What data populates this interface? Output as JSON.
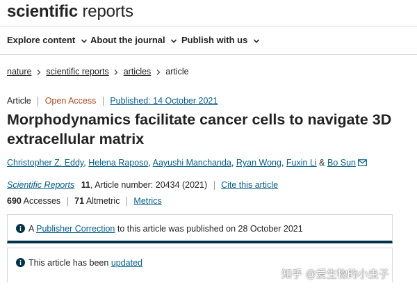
{
  "header": {
    "logo_bold": "scientific",
    "logo_light": "reports"
  },
  "nav": {
    "items": [
      {
        "label": "Explore content"
      },
      {
        "label": "About the journal"
      },
      {
        "label": "Publish with us"
      }
    ]
  },
  "breadcrumb": {
    "items": [
      "nature",
      "scientific reports",
      "articles"
    ],
    "current": "article"
  },
  "article": {
    "type": "Article",
    "access": "Open Access",
    "published": "Published: 14 October 2021",
    "title": "Morphodynamics facilitate cancer cells to navigate 3D extracellular matrix",
    "authors": [
      "Christopher Z. Eddy",
      "Helena Raposo",
      "Aayushi Manchanda",
      "Ryan Wong",
      "Fuxin Li",
      "Bo Sun"
    ],
    "author_sep": ", ",
    "author_and": " & ",
    "journal": "Scientific Reports",
    "volume": "11",
    "article_number": ", Article number: 20434 (2021)",
    "cite_label": "Cite this article",
    "accesses_count": "690",
    "accesses_label": "Accesses",
    "altmetric_count": "71",
    "altmetric_label": "Altmetric",
    "metrics_label": "Metrics"
  },
  "notices": {
    "correction_prefix": "A ",
    "correction_link": "Publisher Correction",
    "correction_suffix": " to this article was published on 28 October 2021",
    "updated_prefix": "This article has been ",
    "updated_link": "updated"
  },
  "watermark": "知乎 @爱生物的小虫子",
  "colors": {
    "link": "#025e8d",
    "open_access": "#b24a1e",
    "notice_border": "#01324b"
  }
}
